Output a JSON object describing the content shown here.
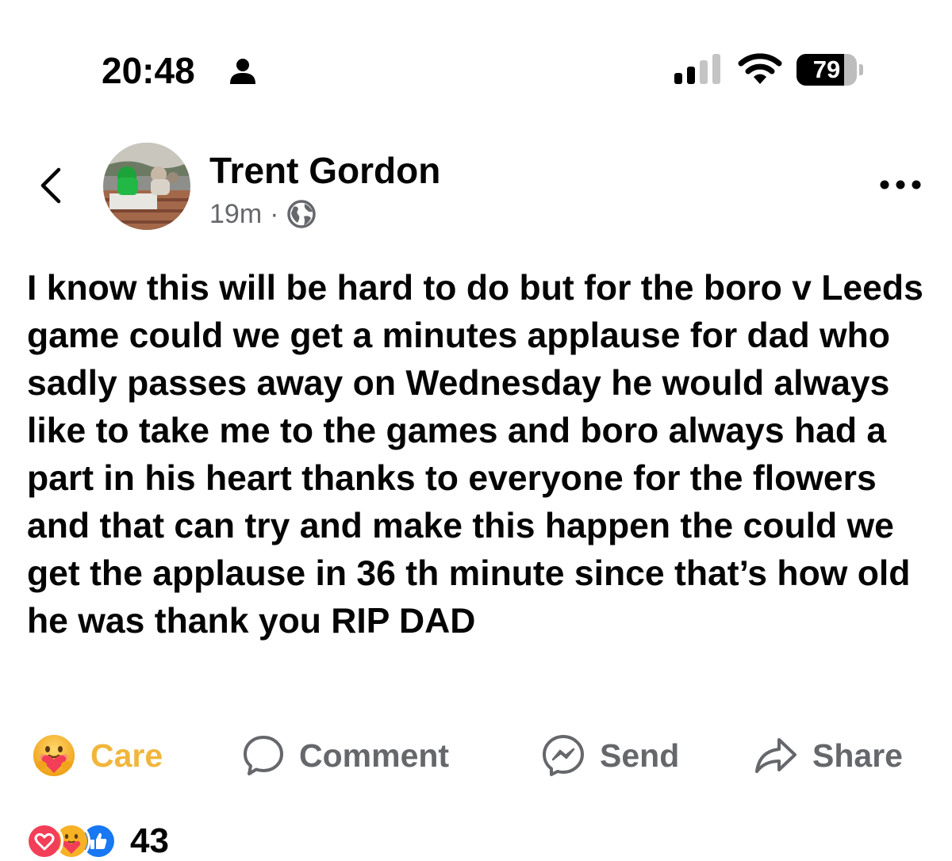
{
  "status_bar": {
    "time": "20:48",
    "battery": "79",
    "battery_level": 0.79,
    "icons": [
      "person-icon",
      "signal-icon",
      "wifi-icon",
      "battery-icon"
    ]
  },
  "post": {
    "author": "Trent Gordon",
    "timestamp": "19m",
    "separator": "·",
    "privacy_icon": "globe-icon",
    "text": "I know this will be hard to do but for the boro v Leeds game could we get a minutes applause for dad who sadly passes away on Wednesday he would always like to take me to the games and boro always had a part in his heart thanks to everyone for the flowers and that can try and make this happen the could we get the applause in 36 th minute since that’s how old he was thank you RIP DAD"
  },
  "actions": {
    "care": "Care",
    "comment": "Comment",
    "send": "Send",
    "share": "Share"
  },
  "reactions": {
    "types": [
      "love",
      "care",
      "like"
    ],
    "count": "43"
  },
  "colors": {
    "care": "#f0b63b",
    "secondary_text": "#65676b",
    "love": "#f33e58",
    "like": "#1877f2"
  }
}
